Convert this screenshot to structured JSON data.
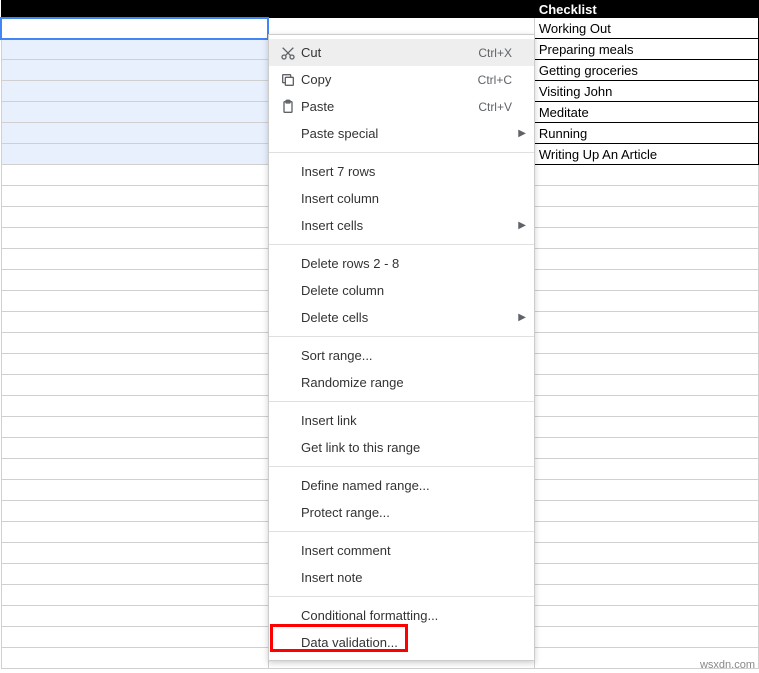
{
  "header": {
    "col1": "",
    "col2": "",
    "col3": "Checklist"
  },
  "checklist_items": [
    "Working Out",
    "Preparing meals",
    "Getting groceries",
    "Visiting John",
    "Meditate",
    "Running",
    "Writing Up An Article"
  ],
  "context_menu": {
    "cut": {
      "label": "Cut",
      "shortcut": "Ctrl+X"
    },
    "copy": {
      "label": "Copy",
      "shortcut": "Ctrl+C"
    },
    "paste": {
      "label": "Paste",
      "shortcut": "Ctrl+V"
    },
    "paste_special": {
      "label": "Paste special"
    },
    "insert_rows": {
      "label": "Insert 7 rows"
    },
    "insert_column": {
      "label": "Insert column"
    },
    "insert_cells": {
      "label": "Insert cells"
    },
    "delete_rows": {
      "label": "Delete rows 2 - 8"
    },
    "delete_column": {
      "label": "Delete column"
    },
    "delete_cells": {
      "label": "Delete cells"
    },
    "sort_range": {
      "label": "Sort range..."
    },
    "randomize_range": {
      "label": "Randomize range"
    },
    "insert_link": {
      "label": "Insert link"
    },
    "get_link": {
      "label": "Get link to this range"
    },
    "define_named": {
      "label": "Define named range..."
    },
    "protect_range": {
      "label": "Protect range..."
    },
    "insert_comment": {
      "label": "Insert comment"
    },
    "insert_note": {
      "label": "Insert note"
    },
    "conditional_formatting": {
      "label": "Conditional formatting..."
    },
    "data_validation": {
      "label": "Data validation..."
    }
  },
  "watermark": "wsxdn.com"
}
